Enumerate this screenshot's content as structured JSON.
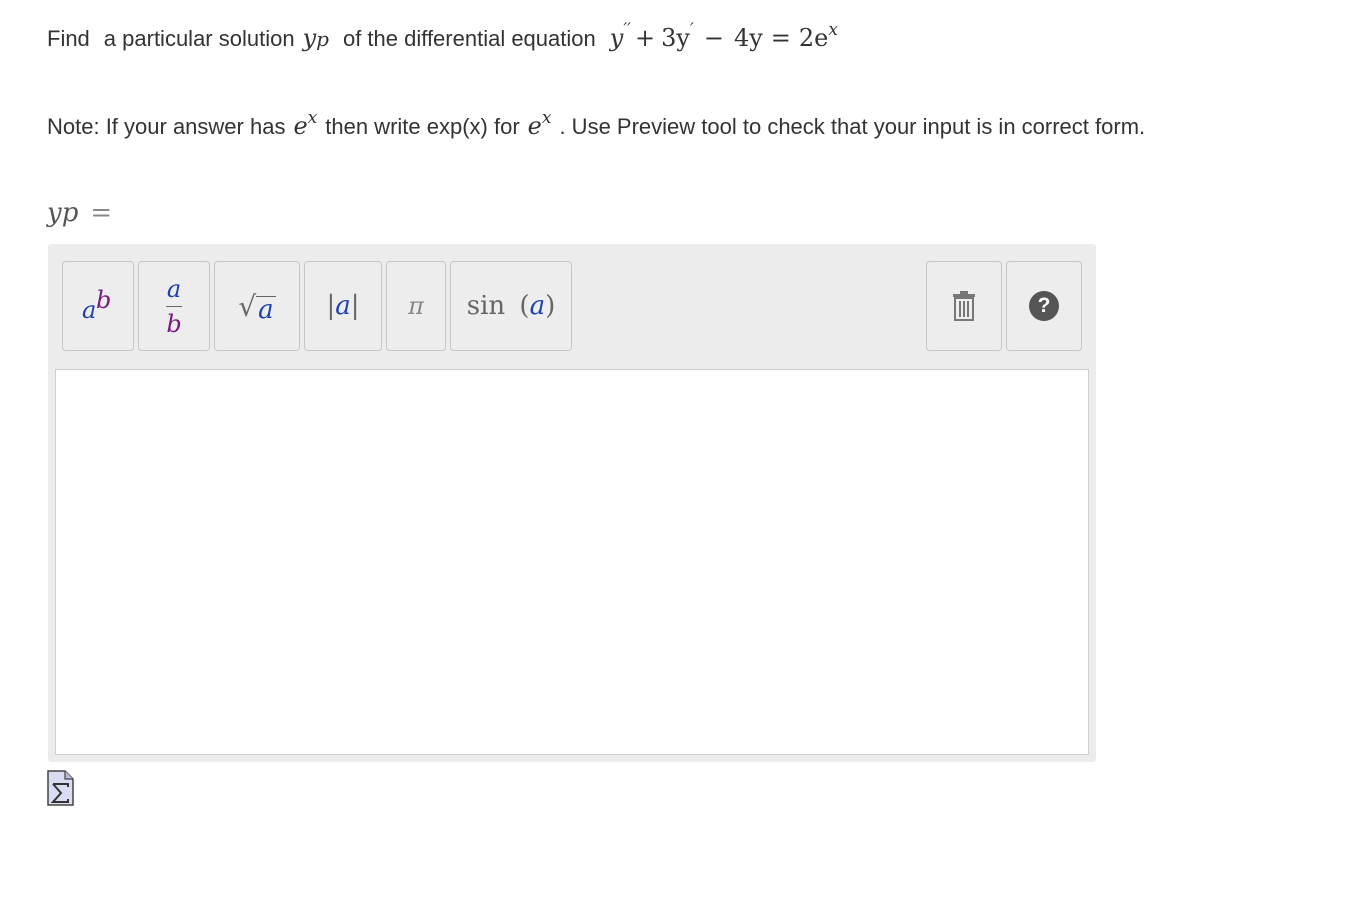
{
  "question": {
    "find_text": "Find",
    "particular_text": "a particular solution",
    "yp_symbol": "y",
    "yp_sub": "p",
    "of_text": "of the differential equation",
    "equation": {
      "y": "y",
      "dprime": "′′",
      "plus": "+",
      "three_y": "3y",
      "prime": "′",
      "minus": "−",
      "four_y": "4y",
      "equals": "=",
      "rhs_coef": "2e",
      "rhs_exp": "x"
    }
  },
  "note": {
    "prefix": "Note: If your answer has",
    "e1": "e",
    "x1": "x",
    "middle": "then write exp(x) for",
    "e2": "e",
    "x2": "x",
    "suffix": ". Use Preview tool to check that your input is in correct form."
  },
  "answer_label": {
    "symbol": "yp",
    "equals": "="
  },
  "toolbar": {
    "power": {
      "base": "a",
      "exp": "b"
    },
    "fraction": {
      "num": "a",
      "den": "b"
    },
    "sqrt": {
      "radical": "√",
      "arg": "a"
    },
    "abs": {
      "left": "|",
      "arg": "a",
      "right": "|"
    },
    "pi": "π",
    "sin": {
      "fn": "sin",
      "open": "(",
      "arg": "a",
      "close": ")"
    },
    "help": "?"
  },
  "icons": {
    "trash": "trash-icon",
    "help": "help-icon",
    "preview": "preview-sigma-icon"
  },
  "colors": {
    "toolbar_bg": "#ececec",
    "var_blue": "#1f3fb5",
    "var_purple": "#7a1a82"
  }
}
